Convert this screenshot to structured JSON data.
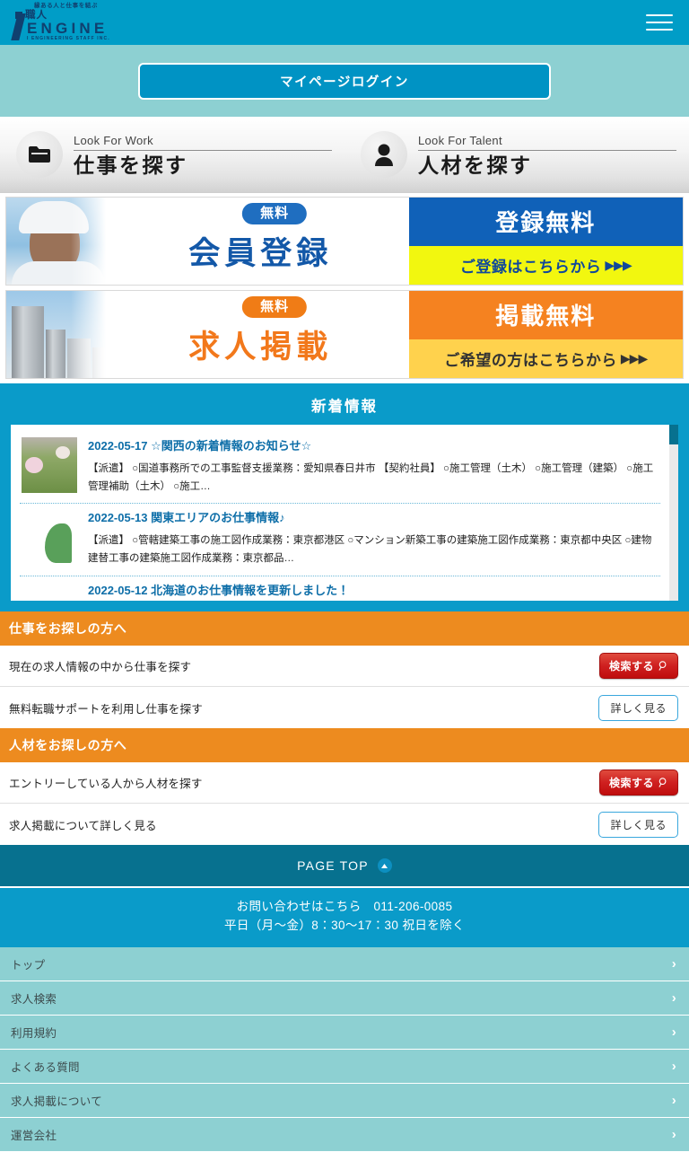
{
  "header": {
    "logo_tagline": "縁ある人と仕事を結ぶ",
    "logo_kanji": "職人",
    "logo_name": "ENGINE",
    "logo_subtitle": "I ENGINEERING STAFF INC.",
    "menu_icon": "hamburger-menu-icon",
    "brand_color": "#009dc7"
  },
  "login": {
    "button_label": "マイページログイン"
  },
  "lookfor": [
    {
      "en": "Look For Work",
      "jp": "仕事を探す",
      "icon": "folder-icon"
    },
    {
      "en": "Look For Talent",
      "jp": "人材を探す",
      "icon": "person-icon"
    }
  ],
  "banners": [
    {
      "free_badge": "無料",
      "headline": "会員登録",
      "right_top": "登録無料",
      "right_bottom": "ご登録はこちらから",
      "arrows": "▶▶▶",
      "accent": "#1061b8",
      "highlight": "#f2f70f"
    },
    {
      "free_badge": "無料",
      "headline": "求人掲載",
      "right_top": "掲載無料",
      "right_bottom": "ご希望の方はこちらから",
      "arrows": "▶▶▶",
      "accent": "#f58220",
      "highlight": "#ffd24d"
    }
  ],
  "news": {
    "title": "新着情報",
    "items": [
      {
        "date": "2022-05-17",
        "headline": "☆関西の新着情報のお知らせ☆",
        "desc": "【派遣】 ○国道事務所での工事監督支援業務：愛知県春日井市 【契約社員】 ○施工管理（土木） ○施工管理（建築） ○施工管理補助（土木） ○施工…",
        "thumb": "flower-garden-photo"
      },
      {
        "date": "2022-05-13",
        "headline": "関東エリアのお仕事情報♪",
        "desc": "【派遣】 ○管轄建築工事の施工図作成業務：東京都港区 ○マンション新築工事の建築施工図作成業務：東京都中央区 ○建物建替工事の建築施工図作成業務：東京都品…",
        "thumb": "green-leaf-photo"
      },
      {
        "date": "2022-05-12",
        "headline": "北海道のお仕事情報を更新しました！",
        "desc": "",
        "thumb": ""
      }
    ]
  },
  "sections": [
    {
      "heading": "仕事をお探しの方へ",
      "rows": [
        {
          "label": "現在の求人情報の中から仕事を探す",
          "button": "検索する",
          "button_type": "search",
          "icon": "magnifier-icon"
        },
        {
          "label": "無料転職サポートを利用し仕事を探す",
          "button": "詳しく見る",
          "button_type": "detail",
          "icon": ""
        }
      ]
    },
    {
      "heading": "人材をお探しの方へ",
      "rows": [
        {
          "label": "エントリーしている人から人材を探す",
          "button": "検索する",
          "button_type": "search",
          "icon": "magnifier-icon"
        },
        {
          "label": "求人掲載について詳しく見る",
          "button": "詳しく見る",
          "button_type": "detail",
          "icon": ""
        }
      ]
    }
  ],
  "pagetop": {
    "label": "PAGE TOP",
    "icon": "arrow-up-circle-icon"
  },
  "contact": {
    "line1": "お問い合わせはこちら　011-206-0085",
    "line2": "平日（月～金）8：30～17：30 祝日を除く"
  },
  "footer_nav": [
    {
      "label": "トップ"
    },
    {
      "label": "求人検索"
    },
    {
      "label": "利用規約"
    },
    {
      "label": "よくある質問"
    },
    {
      "label": "求人掲載について"
    },
    {
      "label": "運営会社"
    }
  ]
}
